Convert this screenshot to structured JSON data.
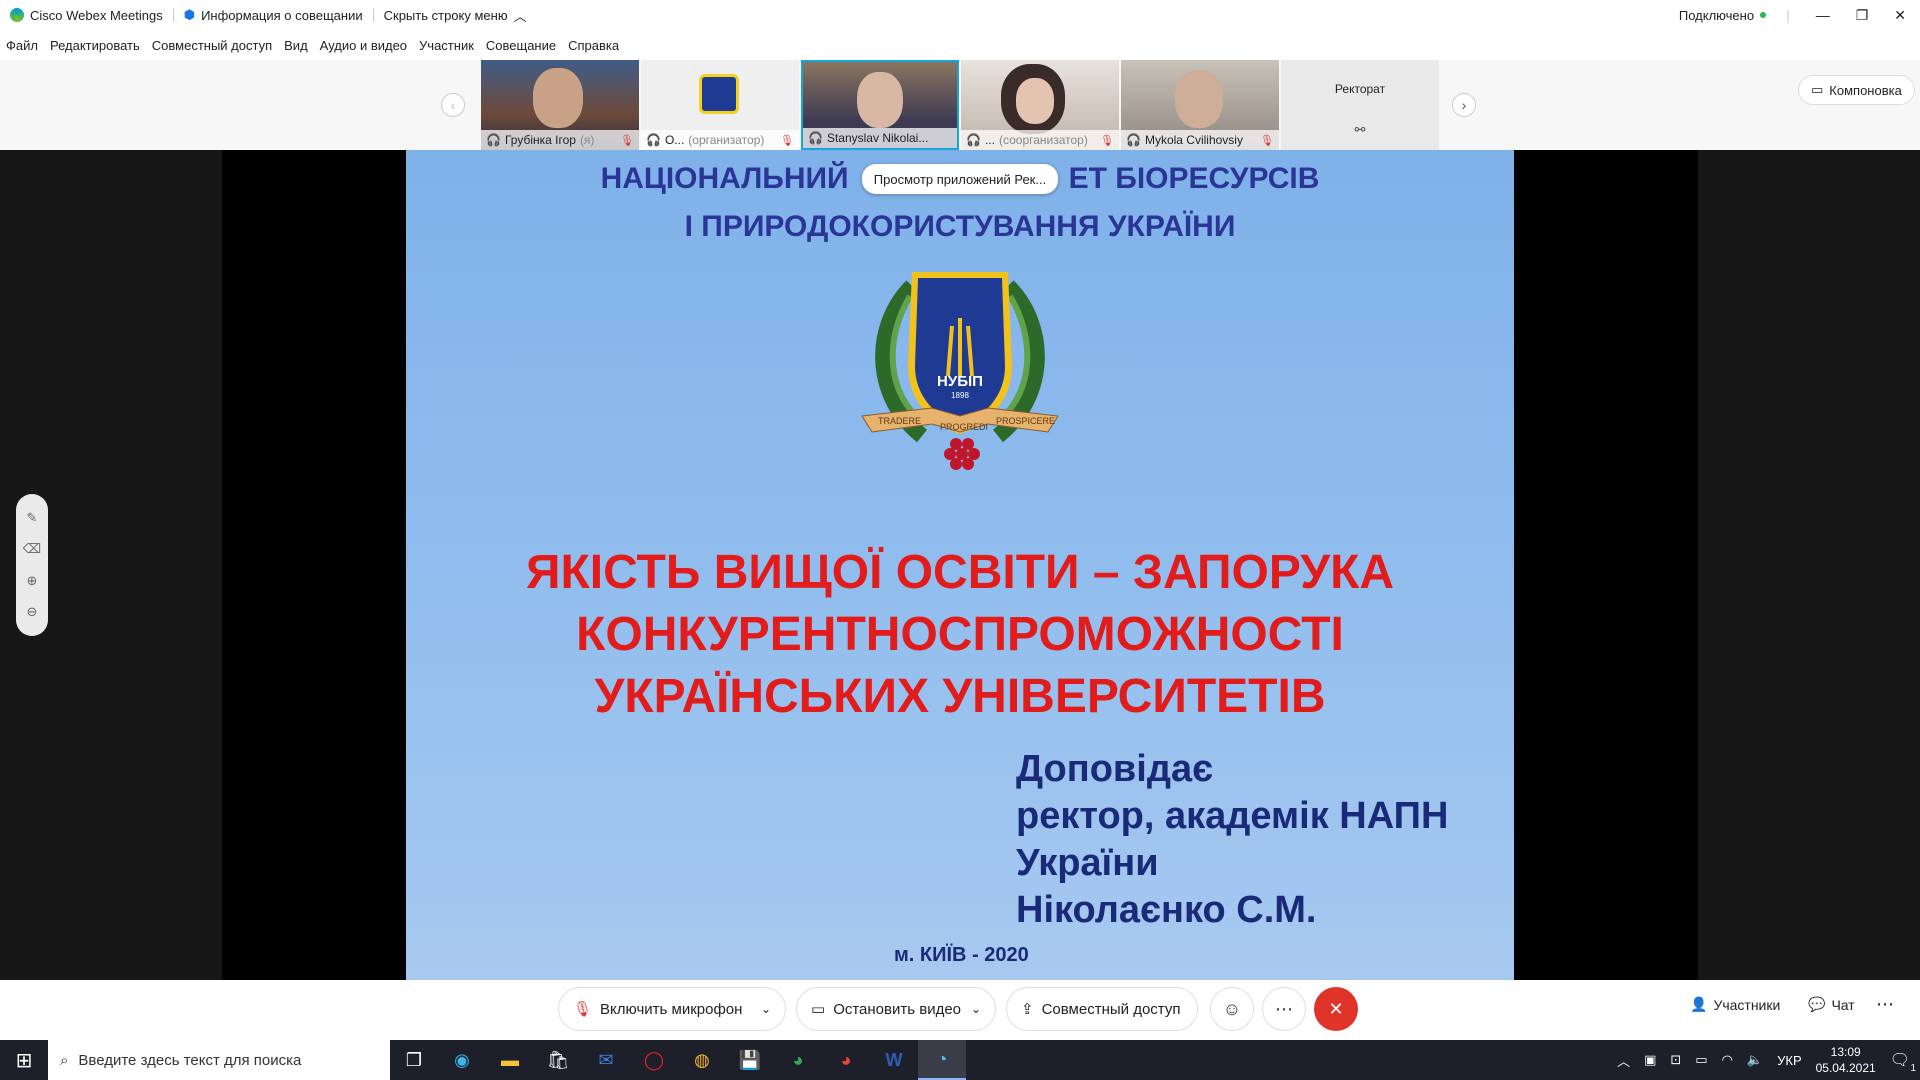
{
  "titlebar": {
    "app_name": "Cisco Webex Meetings",
    "meeting_info": "Информация о совещании",
    "hide_menu": "Скрыть строку меню",
    "status": "Подключено",
    "status_color": "#2fb34a"
  },
  "menu": [
    "Файл",
    "Редактировать",
    "Совместный доступ",
    "Вид",
    "Аудио и видео",
    "Участник",
    "Совещание",
    "Справка"
  ],
  "participants": [
    {
      "name": "Грубінка Ігор",
      "tag": "(я)"
    },
    {
      "name": "О...",
      "tag": "(организатор)"
    },
    {
      "name": "Stanyslav Nikolai...",
      "tag": ""
    },
    {
      "name": "...",
      "tag": "(соорганизатор)"
    },
    {
      "name": "Mykola Cvilihovsiy",
      "tag": ""
    },
    {
      "name": "Ректорат",
      "tag": ""
    }
  ],
  "layout_button": "Компоновка",
  "tooltip": "Просмотр приложений Рек...",
  "slide": {
    "heading_line1_left": "НАЦІОНАЛЬНИЙ",
    "heading_line1_right": "ЕТ БІОРЕСУРСІВ",
    "heading_line2": "І ПРИРОДОКОРИСТУВАННЯ УКРАЇНИ",
    "logo_text": "НУБІП",
    "logo_year": "1898",
    "ribbon": [
      "TRADERE",
      "PROGREDI",
      "PROSPICERE"
    ],
    "title_lines": [
      "ЯКІСТЬ ВИЩОЇ ОСВІТИ – ЗАПОРУКА",
      "КОНКУРЕНТНОСПРОМОЖНОСТІ",
      "УКРАЇНСЬКИХ УНІВЕРСИТЕТІВ"
    ],
    "speaker_lines": [
      "Доповідає",
      "ректор, академік НАПН",
      "України",
      "Ніколаєнко С.М."
    ],
    "city": "м. КИЇВ - 2020",
    "heading_color": "#2b3596",
    "title_color": "#e21b1b"
  },
  "controls": {
    "mic": "Включить микрофон",
    "video": "Остановить видео",
    "share": "Совместный доступ",
    "participants": "Участники",
    "chat": "Чат",
    "leave_color": "#e0342a"
  },
  "taskbar": {
    "search_placeholder": "Введите здесь текст для поиска",
    "lang": "УКР",
    "time": "13:09",
    "date": "05.04.2021",
    "notifications": "1"
  }
}
